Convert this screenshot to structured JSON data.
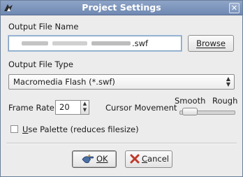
{
  "window": {
    "title": "Project Settings",
    "close_symbol": "✕"
  },
  "output_file": {
    "label": "Output File Name",
    "value_suffix": ".swf",
    "browse_label": "Browse"
  },
  "file_type": {
    "label": "Output File Type",
    "selected": "Macromedia Flash (*.swf)"
  },
  "frame_rate": {
    "label": "Frame Rate",
    "value": "20"
  },
  "cursor_movement": {
    "label": "Cursor Movement",
    "min_label": "Smooth",
    "max_label": "Rough",
    "level": 0.1
  },
  "use_palette": {
    "label": "Use Palette (reduces filesize)",
    "checked": false
  },
  "buttons": {
    "ok_label": "OK",
    "cancel_label": "Cancel"
  },
  "icons": {
    "app": "app-icon",
    "close": "close-icon",
    "combo_arrows": "updown-arrows-icon",
    "ok": "ok-hand-icon",
    "cancel": "cancel-x-icon"
  },
  "colors": {
    "titlebar": "#7b93bb",
    "dialog_bg": "#ececec",
    "focus": "#a9c2e4",
    "cancel_x": "#c0392b"
  }
}
